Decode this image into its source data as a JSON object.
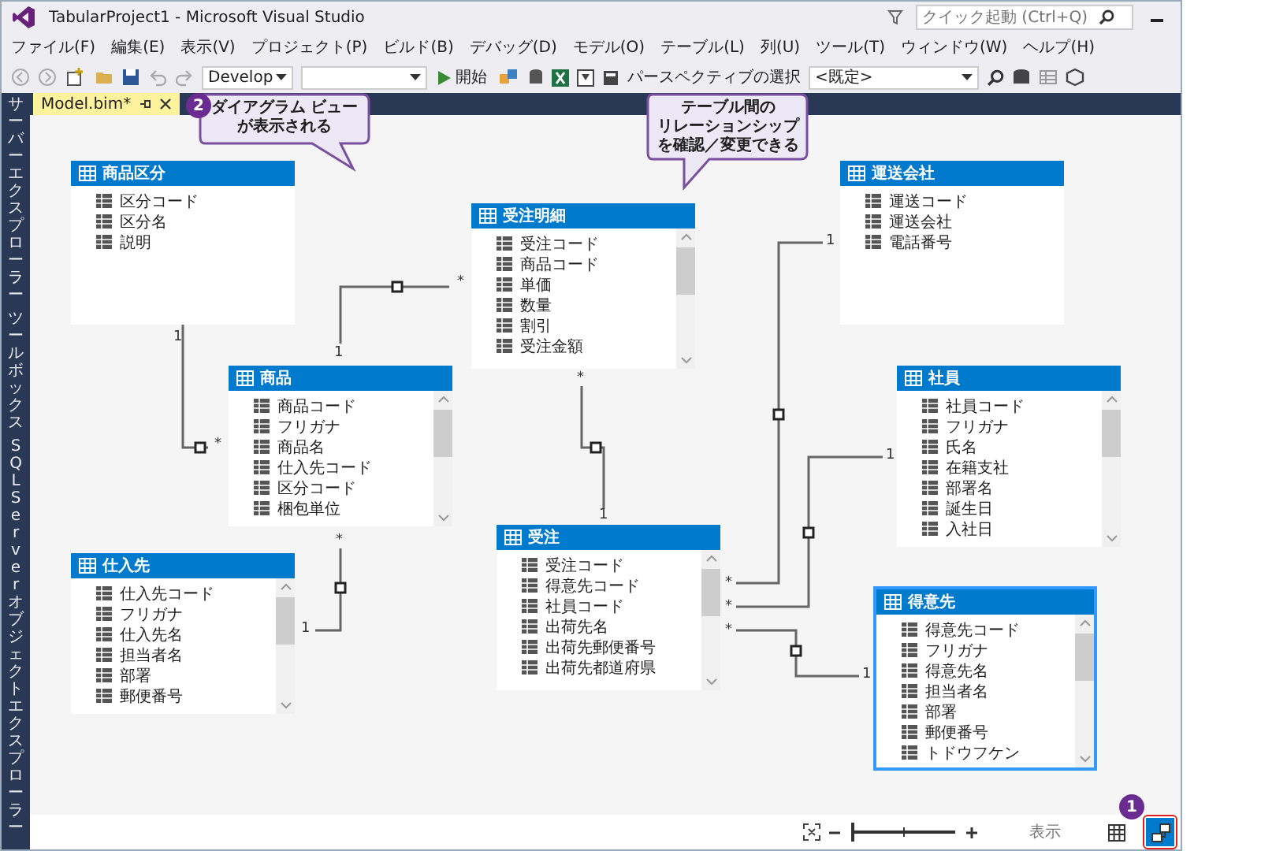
{
  "window": {
    "title": "TabularProject1 - Microsoft Visual Studio"
  },
  "quick_launch": {
    "placeholder": "クイック起動 (Ctrl+Q)"
  },
  "menu": [
    "ファイル(F)",
    "編集(E)",
    "表示(V)",
    "プロジェクト(P)",
    "ビルド(B)",
    "デバッグ(D)",
    "モデル(O)",
    "テーブル(L)",
    "列(U)",
    "ツール(T)",
    "ウィンドウ(W)",
    "ヘルプ(H)"
  ],
  "toolbar": {
    "configuration": "Develop",
    "start_button": "開始",
    "perspective_label": "パースペクティブの選択",
    "perspective_value": "<既定>"
  },
  "sidebar_tabs": [
    "サーバーエクスプローラー",
    "ツールボックス",
    "SQL Server オブジェクトエクスプローラー"
  ],
  "document_tabs": [
    {
      "label": "Model.bim*",
      "selected": true
    }
  ],
  "tables": [
    {
      "name": "商品区分",
      "selected": false,
      "scrollable": false,
      "columns": [
        "区分コード",
        "区分名",
        "説明"
      ]
    },
    {
      "name": "受注明細",
      "selected": false,
      "scrollable": true,
      "columns": [
        "受注コード",
        "商品コード",
        "単価",
        "数量",
        "割引",
        "受注金額"
      ]
    },
    {
      "name": "運送会社",
      "selected": false,
      "scrollable": false,
      "columns": [
        "運送コード",
        "運送会社",
        "電話番号"
      ]
    },
    {
      "name": "商品",
      "selected": false,
      "scrollable": true,
      "columns": [
        "商品コード",
        "フリガナ",
        "商品名",
        "仕入先コード",
        "区分コード",
        "梱包単位"
      ]
    },
    {
      "name": "社員",
      "selected": false,
      "scrollable": true,
      "columns": [
        "社員コード",
        "フリガナ",
        "氏名",
        "在籍支社",
        "部署名",
        "誕生日",
        "入社日"
      ]
    },
    {
      "name": "仕入先",
      "selected": false,
      "scrollable": true,
      "columns": [
        "仕入先コード",
        "フリガナ",
        "仕入先名",
        "担当者名",
        "部署",
        "郵便番号"
      ]
    },
    {
      "name": "受注",
      "selected": false,
      "scrollable": true,
      "columns": [
        "受注コード",
        "得意先コード",
        "社員コード",
        "出荷先名",
        "出荷先郵便番号",
        "出荷先都道府県"
      ]
    },
    {
      "name": "得意先",
      "selected": true,
      "scrollable": true,
      "columns": [
        "得意先コード",
        "フリガナ",
        "得意先名",
        "担当者名",
        "部署",
        "郵便番号",
        "トドウフケン"
      ]
    }
  ],
  "relationships": [
    {
      "ends": [
        "1",
        "*"
      ]
    },
    {
      "ends": [
        "1",
        "*"
      ]
    },
    {
      "ends": [
        "*",
        "1"
      ]
    },
    {
      "ends": [
        "1",
        "*"
      ]
    },
    {
      "ends": [
        "1",
        "*"
      ]
    },
    {
      "ends": [
        "*",
        "1"
      ]
    },
    {
      "ends": [
        "*",
        "1"
      ]
    }
  ],
  "zoom": {
    "level": 0
  },
  "view_label": "表示",
  "views": [
    {
      "kind": "grid",
      "selected": false
    },
    {
      "kind": "diagram",
      "selected": true
    }
  ],
  "callouts": [
    {
      "badge": "2",
      "lines": [
        "ダイアグラム ビュー",
        "が表示される"
      ]
    },
    {
      "lines": [
        "テーブル間の",
        "リレーションシップ",
        "を確認／変更できる"
      ]
    }
  ],
  "highlight": {
    "badge": "1"
  }
}
